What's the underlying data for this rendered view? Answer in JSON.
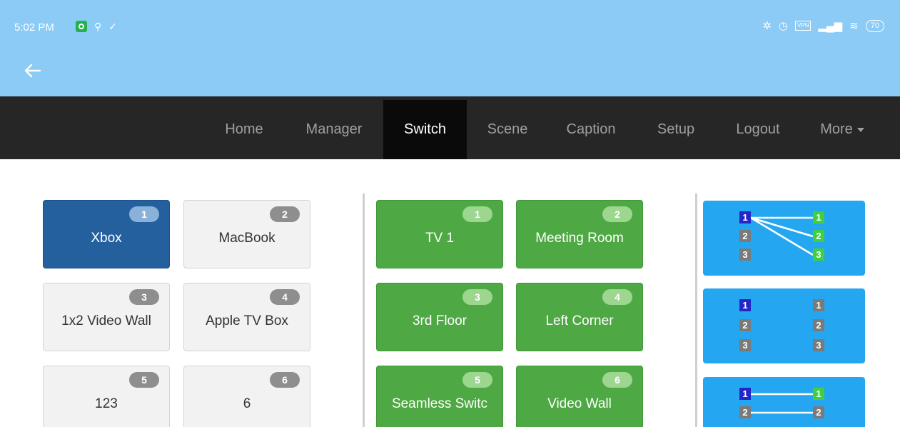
{
  "status_bar": {
    "time": "5:02 PM",
    "battery": "70",
    "left_icons": [
      "app-icon",
      "location-icon",
      "check-icon"
    ],
    "right_icons": [
      "bluetooth-icon",
      "alarm-icon",
      "vpn-icon",
      "signal-icon",
      "wifi-icon",
      "battery-icon"
    ]
  },
  "app_bar": {
    "back_icon": "back-arrow-icon"
  },
  "nav": {
    "items": [
      "Home",
      "Manager",
      "Switch",
      "Scene",
      "Caption",
      "Setup",
      "Logout",
      "More"
    ],
    "active": "Switch"
  },
  "sources": [
    {
      "num": "1",
      "label": "Xbox",
      "selected": true
    },
    {
      "num": "2",
      "label": "MacBook"
    },
    {
      "num": "3",
      "label": "1x2 Video Wall"
    },
    {
      "num": "4",
      "label": "Apple TV Box"
    },
    {
      "num": "5",
      "label": "123"
    },
    {
      "num": "6",
      "label": "6"
    }
  ],
  "displays": [
    {
      "num": "1",
      "label": "TV 1"
    },
    {
      "num": "2",
      "label": "Meeting Room"
    },
    {
      "num": "3",
      "label": "3rd Floor"
    },
    {
      "num": "4",
      "label": "Left Corner"
    },
    {
      "num": "5",
      "label": "Seamless Switc"
    },
    {
      "num": "6",
      "label": "Video Wall"
    }
  ],
  "scenes": [
    {
      "inputs": [
        "1",
        "2",
        "3"
      ],
      "outputs": [
        "1",
        "2",
        "3"
      ],
      "mapping": "1 to all"
    },
    {
      "inputs": [
        "1",
        "2",
        "3"
      ],
      "outputs": [
        "1",
        "2",
        "3"
      ],
      "mapping": "none"
    },
    {
      "inputs": [
        "1",
        "2"
      ],
      "outputs": [
        "1",
        "2"
      ],
      "mapping": "one to one"
    }
  ],
  "colors": {
    "app_bar": "#8bcbf5",
    "nav_bar": "#262626",
    "selected_source": "#245f9e",
    "display_tile": "#4ea843",
    "scene_card": "#24a7f0",
    "input_badge": "#2626c8",
    "output_badge": "#3ed13e",
    "inactive_badge": "#7a7a7a"
  }
}
